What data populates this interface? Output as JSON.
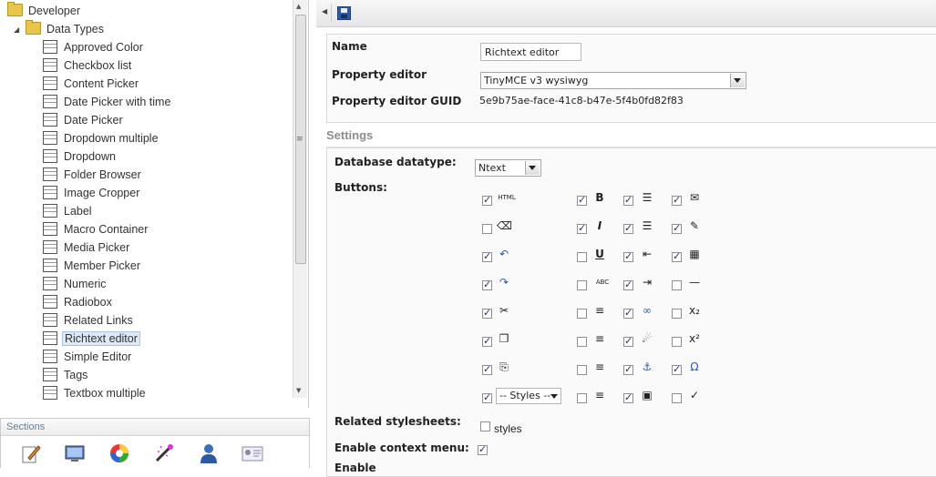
{
  "tree": {
    "root_label": "Developer",
    "folder_label": "Data Types",
    "items": [
      "Approved Color",
      "Checkbox list",
      "Content Picker",
      "Date Picker with time",
      "Date Picker",
      "Dropdown multiple",
      "Dropdown",
      "Folder Browser",
      "Image Cropper",
      "Label",
      "Macro Container",
      "Media Picker",
      "Member Picker",
      "Numeric",
      "Radiobox",
      "Related Links",
      "Richtext editor",
      "Simple Editor",
      "Tags",
      "Textbox multiple"
    ],
    "selected": "Richtext editor"
  },
  "sections": {
    "title": "Sections",
    "icons": [
      "content-section-icon",
      "media-section-icon",
      "settings-section-icon",
      "developer-section-icon",
      "users-section-icon",
      "members-section-icon"
    ]
  },
  "form": {
    "name_label": "Name",
    "name_value": "Richtext editor",
    "editor_label": "Property editor",
    "editor_value": "TinyMCE v3 wysiwyg",
    "guid_label": "Property editor GUID",
    "guid_value": "5e9b75ae-face-41c8-b47e-5f4b0fd82f83",
    "settings_title": "Settings",
    "db_label": "Database datatype:",
    "db_value": "Ntext",
    "buttons_label": "Buttons:",
    "styles_dropdown": "-- Styles --",
    "related_label": "Related stylesheets:",
    "related_option": "styles",
    "context_label": "Enable context menu:",
    "next_label": "Enable"
  },
  "buttons_grid": [
    [
      {
        "icon": "html-icon",
        "glyph": "HTML",
        "on": true
      },
      {
        "icon": "bold-icon",
        "glyph": "B",
        "on": true
      },
      {
        "icon": "bullet-list-icon",
        "glyph": "☰",
        "on": true
      },
      {
        "icon": "insert-email-icon",
        "glyph": "✉",
        "on": true
      }
    ],
    [
      {
        "icon": "eraser-icon",
        "glyph": "⌫",
        "on": false
      },
      {
        "icon": "italic-icon",
        "glyph": "I",
        "on": true
      },
      {
        "icon": "numbered-list-icon",
        "glyph": "☰",
        "on": true
      },
      {
        "icon": "edit-form-icon",
        "glyph": "✎",
        "on": true
      }
    ],
    [
      {
        "icon": "undo-icon",
        "glyph": "↶",
        "on": true
      },
      {
        "icon": "underline-icon",
        "glyph": "U",
        "on": false
      },
      {
        "icon": "outdent-icon",
        "glyph": "⇤",
        "on": true
      },
      {
        "icon": "film-icon",
        "glyph": "▦",
        "on": true
      }
    ],
    [
      {
        "icon": "redo-icon",
        "glyph": "↷",
        "on": true
      },
      {
        "icon": "strikethrough-icon",
        "glyph": "ABC",
        "on": false
      },
      {
        "icon": "indent-icon",
        "glyph": "⇥",
        "on": true
      },
      {
        "icon": "horizontal-rule-icon",
        "glyph": "—",
        "on": false
      }
    ],
    [
      {
        "icon": "cut-icon",
        "glyph": "✂",
        "on": true
      },
      {
        "icon": "align-left-icon",
        "glyph": "≡",
        "on": false
      },
      {
        "icon": "link-icon",
        "glyph": "∞",
        "on": true
      },
      {
        "icon": "subscript-icon",
        "glyph": "x₂",
        "on": false
      }
    ],
    [
      {
        "icon": "copy-icon",
        "glyph": "❐",
        "on": true
      },
      {
        "icon": "align-center-icon",
        "glyph": "≡",
        "on": false
      },
      {
        "icon": "unlink-icon",
        "glyph": "☄",
        "on": true
      },
      {
        "icon": "superscript-icon",
        "glyph": "x²",
        "on": false
      }
    ],
    [
      {
        "icon": "paste-icon",
        "glyph": "⎘",
        "on": true
      },
      {
        "icon": "align-right-icon",
        "glyph": "≡",
        "on": false
      },
      {
        "icon": "anchor-icon",
        "glyph": "⚓",
        "on": true
      },
      {
        "icon": "special-char-icon",
        "glyph": "Ω",
        "on": true
      }
    ],
    [
      {
        "icon": "styles-dropdown",
        "glyph": "",
        "on": true
      },
      {
        "icon": "justify-icon",
        "glyph": "≡",
        "on": false
      },
      {
        "icon": "image-icon",
        "glyph": "▣",
        "on": true
      },
      {
        "icon": "spellcheck-icon",
        "glyph": "✓",
        "on": false
      }
    ]
  ],
  "related_checked": false,
  "context_checked": true
}
